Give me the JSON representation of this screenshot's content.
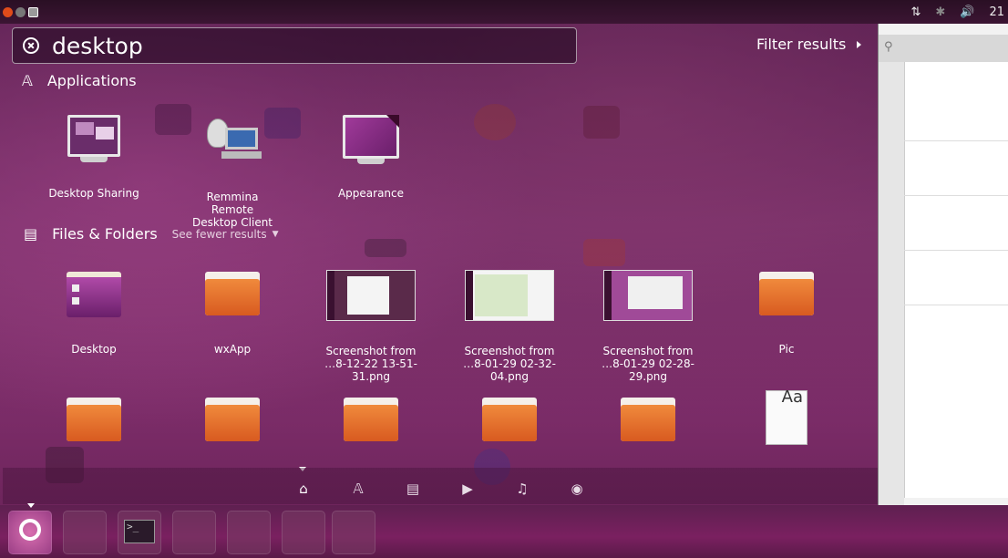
{
  "search": {
    "query": "desktop",
    "filter_label": "Filter results"
  },
  "tray": {
    "clock_partial": "21"
  },
  "sections": {
    "applications": {
      "title": "Applications",
      "items": [
        {
          "label": "Desktop Sharing",
          "icon": "desktop-sharing-icon"
        },
        {
          "label": "Remmina Remote\nDesktop Client",
          "icon": "remmina-icon"
        },
        {
          "label": "Appearance",
          "icon": "appearance-icon"
        }
      ]
    },
    "files": {
      "title": "Files & Folders",
      "see_fewer": "See fewer results",
      "row1": [
        {
          "label": "Desktop",
          "icon": "desktop-folder-icon"
        },
        {
          "label": "wxApp",
          "icon": "folder-icon"
        },
        {
          "label": "Screenshot from\n…8-12-22 13-51-31.png",
          "icon": "image-thumbnail"
        },
        {
          "label": "Screenshot from\n…8-01-29 02-32-04.png",
          "icon": "image-thumbnail"
        },
        {
          "label": "Screenshot from\n…8-01-29 02-28-29.png",
          "icon": "image-thumbnail"
        },
        {
          "label": "Pic",
          "icon": "folder-icon"
        }
      ],
      "row2_icons": [
        "folder-icon",
        "folder-icon",
        "folder-icon",
        "folder-icon",
        "folder-icon",
        "font-file-icon"
      ]
    }
  },
  "lens_bar": [
    "home-lens-icon",
    "applications-lens-icon",
    "files-lens-icon",
    "video-lens-icon",
    "music-lens-icon",
    "photo-lens-icon"
  ],
  "font_preview": "Aa",
  "colors": {
    "folder_orange": "#e8702c",
    "dash_tint": "#a04a88",
    "launcher": "#7a2060"
  }
}
